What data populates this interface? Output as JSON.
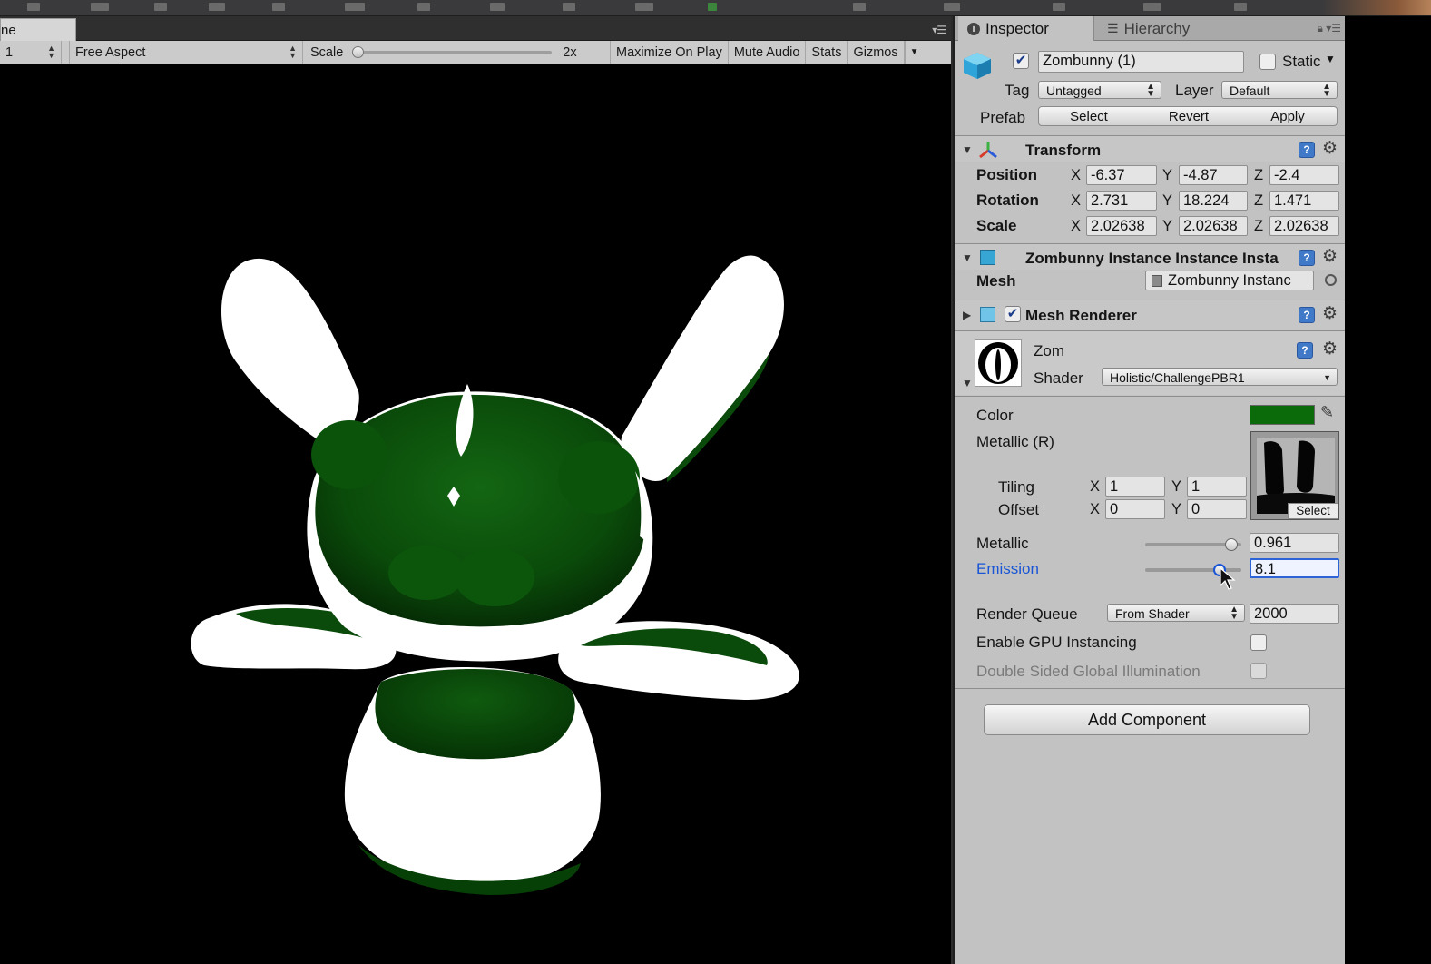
{
  "game_view": {
    "tab_label": "ne",
    "display_value": "1",
    "aspect_value": "Free Aspect",
    "scale_label": "Scale",
    "scale_value": "2x",
    "scale_level": 0.0,
    "buttons": [
      "Maximize On Play",
      "Mute Audio",
      "Stats",
      "Gizmos"
    ]
  },
  "inspector": {
    "tabs": {
      "inspector": "Inspector",
      "hierarchy": "Hierarchy"
    },
    "object": {
      "active": true,
      "name": "Zombunny (1)",
      "static_label": "Static",
      "static_checked": false,
      "tag_label": "Tag",
      "tag_value": "Untagged",
      "layer_label": "Layer",
      "layer_value": "Default",
      "prefab_label": "Prefab",
      "prefab_buttons": {
        "select": "Select",
        "revert": "Revert",
        "apply": "Apply"
      }
    },
    "transform": {
      "title": "Transform",
      "position_label": "Position",
      "rotation_label": "Rotation",
      "scale_label": "Scale",
      "position": {
        "x": "-6.37",
        "y": "-4.87",
        "z": "-2.4"
      },
      "rotation": {
        "x": "2.731",
        "y": "18.224",
        "z": "1.471"
      },
      "scale": {
        "x": "2.02638",
        "y": "2.02638",
        "z": "2.02638"
      }
    },
    "mesh_filter": {
      "title": "Zombunny Instance Instance Insta",
      "mesh_label": "Mesh",
      "mesh_value": "Zombunny Instanc"
    },
    "mesh_renderer": {
      "title": "Mesh Renderer",
      "enabled": true
    },
    "material": {
      "name": "Zom",
      "shader_label": "Shader",
      "shader_value": "Holistic/ChallengePBR1",
      "color_label": "Color",
      "color_hex": "#0b6b0b",
      "metallic_map_label": "Metallic (R)",
      "tiling_label": "Tiling",
      "offset_label": "Offset",
      "tiling": {
        "x": "1",
        "y": "1"
      },
      "offset": {
        "x": "0",
        "y": "0"
      },
      "texture_select": "Select",
      "metallic_label": "Metallic",
      "metallic_value": "0.961",
      "metallic_level": 0.961,
      "emission_label": "Emission",
      "emission_value": "8.1",
      "emission_level": 0.81,
      "render_queue_label": "Render Queue",
      "render_queue_mode": "From Shader",
      "render_queue_value": "2000",
      "gpu_instancing_label": "Enable GPU Instancing",
      "gpu_instancing": false,
      "double_sided_gi_label": "Double Sided Global Illumination",
      "double_sided_gi": false
    },
    "add_component": "Add Component"
  },
  "colors": {
    "accent_blue": "#1a55d6",
    "panel_bg": "#c2c2c2",
    "scene_green": "#0a4a0a"
  }
}
